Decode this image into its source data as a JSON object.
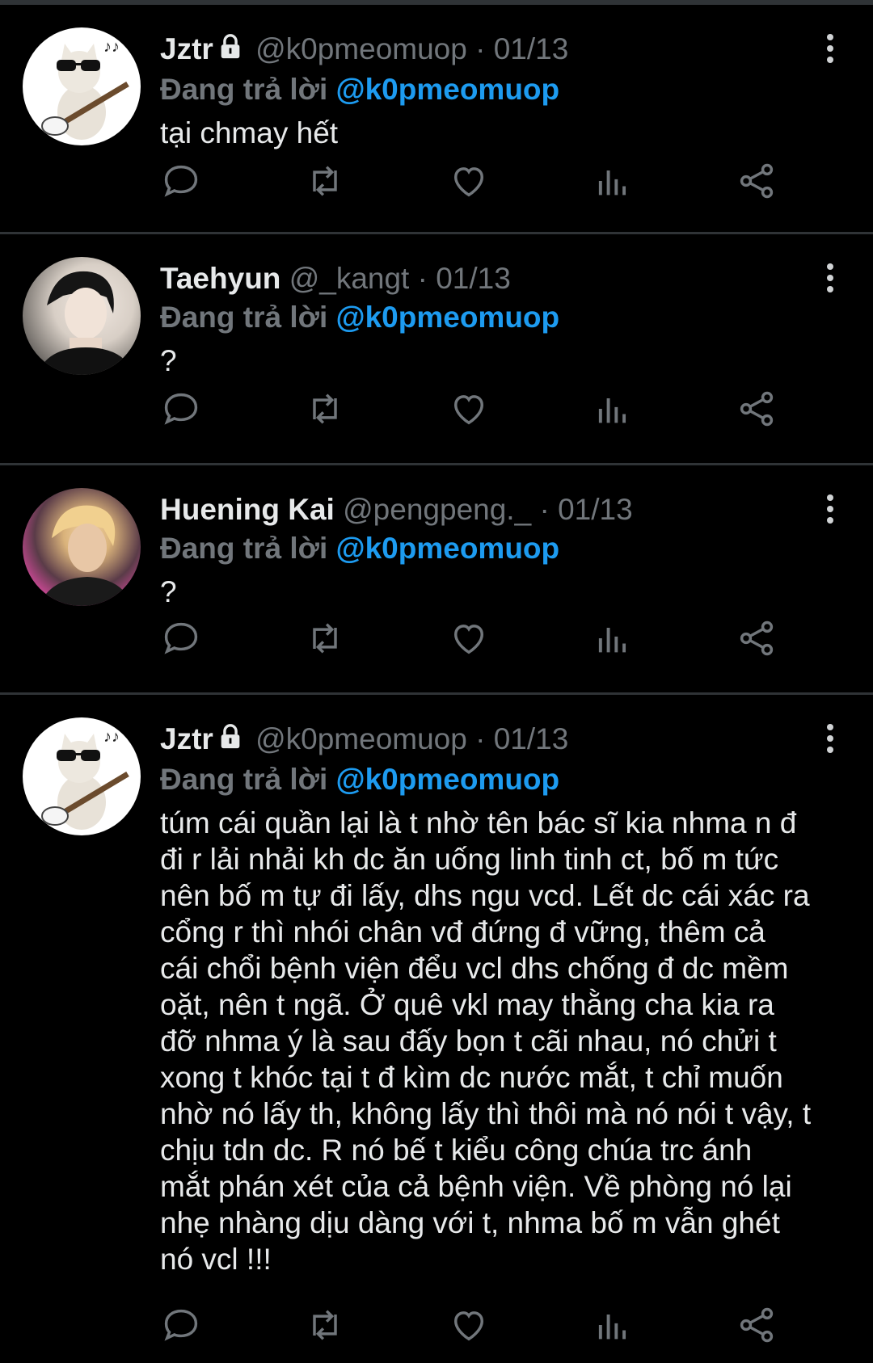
{
  "colors": {
    "background": "#000000",
    "text": "#e7e9ea",
    "muted": "#71767b",
    "accent": "#1d9bf0",
    "divider": "#2f3336"
  },
  "reply_prefix": "Đang trả lời",
  "tweets": [
    {
      "name": "Jztr",
      "locked": true,
      "handle": "@k0pmeomuop",
      "separator": "·",
      "date": "01/13",
      "reply_to": "@k0pmeomuop",
      "text": "tại chmay hết",
      "avatar": "cat-guitar-avatar"
    },
    {
      "name": "Taehyun",
      "locked": false,
      "handle": "@_kangt",
      "separator": "·",
      "date": "01/13",
      "reply_to": "@k0pmeomuop",
      "text": "?",
      "avatar": "person-avatar"
    },
    {
      "name": "Huening Kai",
      "locked": false,
      "handle": "@pengpeng._",
      "separator": "·",
      "date": "01/13",
      "reply_to": "@k0pmeomuop",
      "text": "?",
      "avatar": "person-avatar"
    },
    {
      "name": "Jztr",
      "locked": true,
      "handle": "@k0pmeomuop",
      "separator": "·",
      "date": "01/13",
      "reply_to": "@k0pmeomuop",
      "text": "túm cái quần lại là t nhờ tên bác sĩ kia nhma n đ\nđi r lải nhải kh dc ăn uống linh tinh ct, bố m tức\nnên bố m tự đi lấy, dhs ngu vcd. Lết dc cái xác ra\ncổng r thì nhói chân vđ đứng đ vững, thêm cả\ncái chổi bệnh viện đểu vcl dhs chống đ dc mềm\noặt, nên t ngã. Ở quê vkl may thằng cha kia ra\nđỡ nhma ý là sau đấy bọn t cãi nhau, nó chửi t\nxong t khóc tại t đ kìm dc nước mắt, t chỉ muốn\nnhờ nó lấy th, không lấy thì thôi mà nó nói t vậy, t\nchịu tdn dc. R nó bế t kiểu công chúa trc ánh\nmắt phán xét của cả bệnh viện. Về phòng nó lại\nnhẹ nhàng dịu dàng với t, nhma bố m vẫn ghét\nnó vcl !!!",
      "avatar": "cat-guitar-avatar"
    }
  ],
  "action_icons": [
    "reply-icon",
    "retweet-icon",
    "like-icon",
    "analytics-icon",
    "share-icon"
  ]
}
